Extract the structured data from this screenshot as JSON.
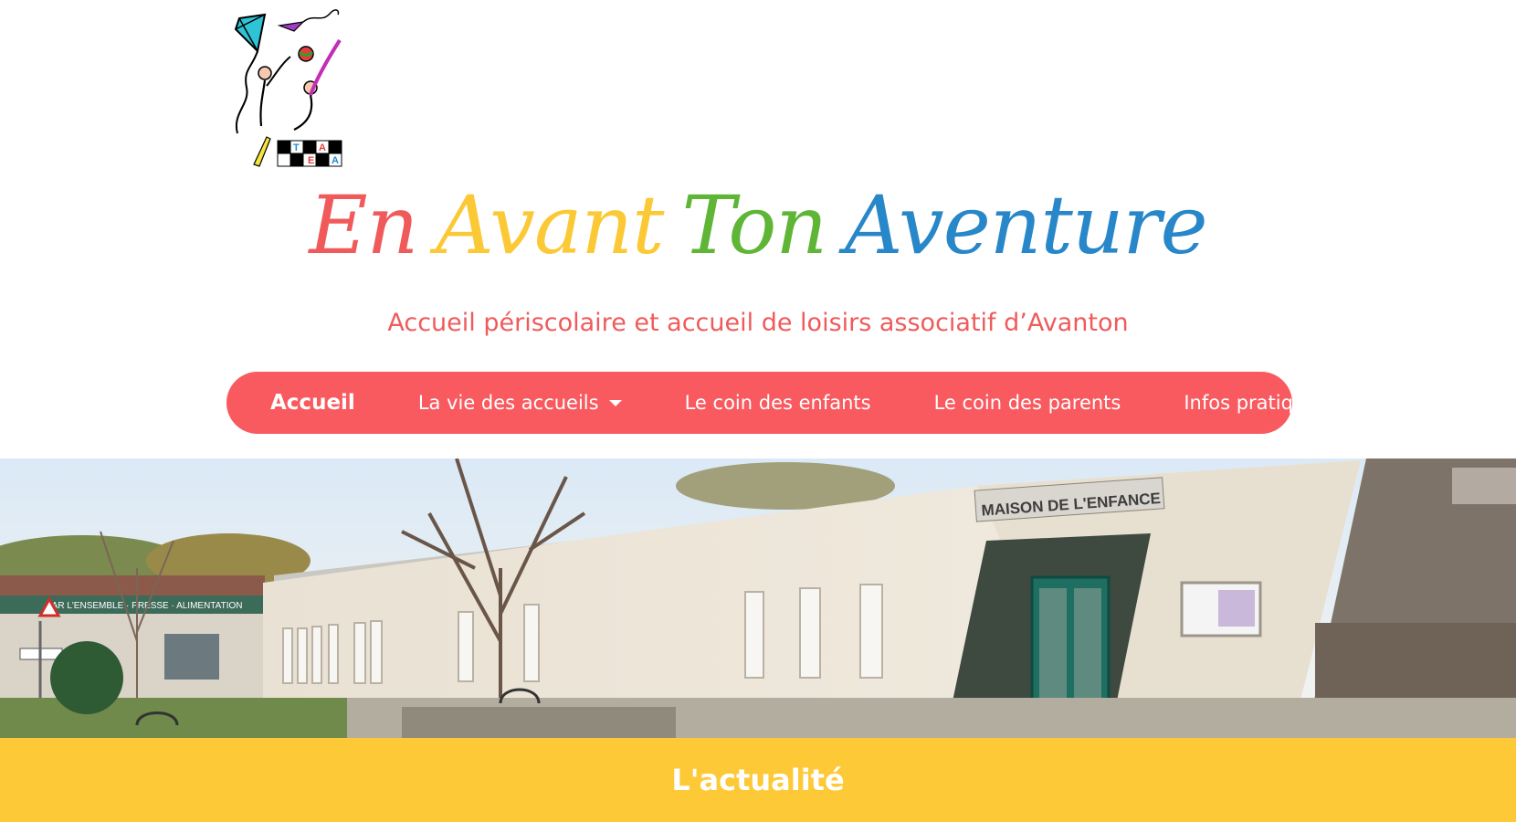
{
  "header": {
    "title_words": [
      {
        "text": "En",
        "color": "#f05a5b"
      },
      {
        "text": "Avant",
        "color": "#fbc935"
      },
      {
        "text": "Ton",
        "color": "#5fb535"
      },
      {
        "text": "Aventure",
        "color": "#2787c9"
      }
    ],
    "tagline": "Accueil périscolaire et accueil de loisirs associatif d’Avanton",
    "tagline_color": "#f05a5b"
  },
  "nav": {
    "background": "#f85a5f",
    "items": [
      {
        "label": "Accueil",
        "active": true
      },
      {
        "label": "La vie des accueils",
        "dropdown": true
      },
      {
        "label": "Le coin des enfants"
      },
      {
        "label": "Le coin des parents"
      },
      {
        "label": "Infos pratiques"
      }
    ]
  },
  "hero": {
    "building_sign": "MAISON DE L'ENFANCE",
    "shop_sign": "BAR L'ENSEMBLE · PRESSE · ALIMENTATION"
  },
  "news": {
    "title": "L'actualité",
    "background": "#fdc936"
  },
  "logo": {
    "letters": [
      "E",
      "A",
      "T",
      "A"
    ]
  }
}
